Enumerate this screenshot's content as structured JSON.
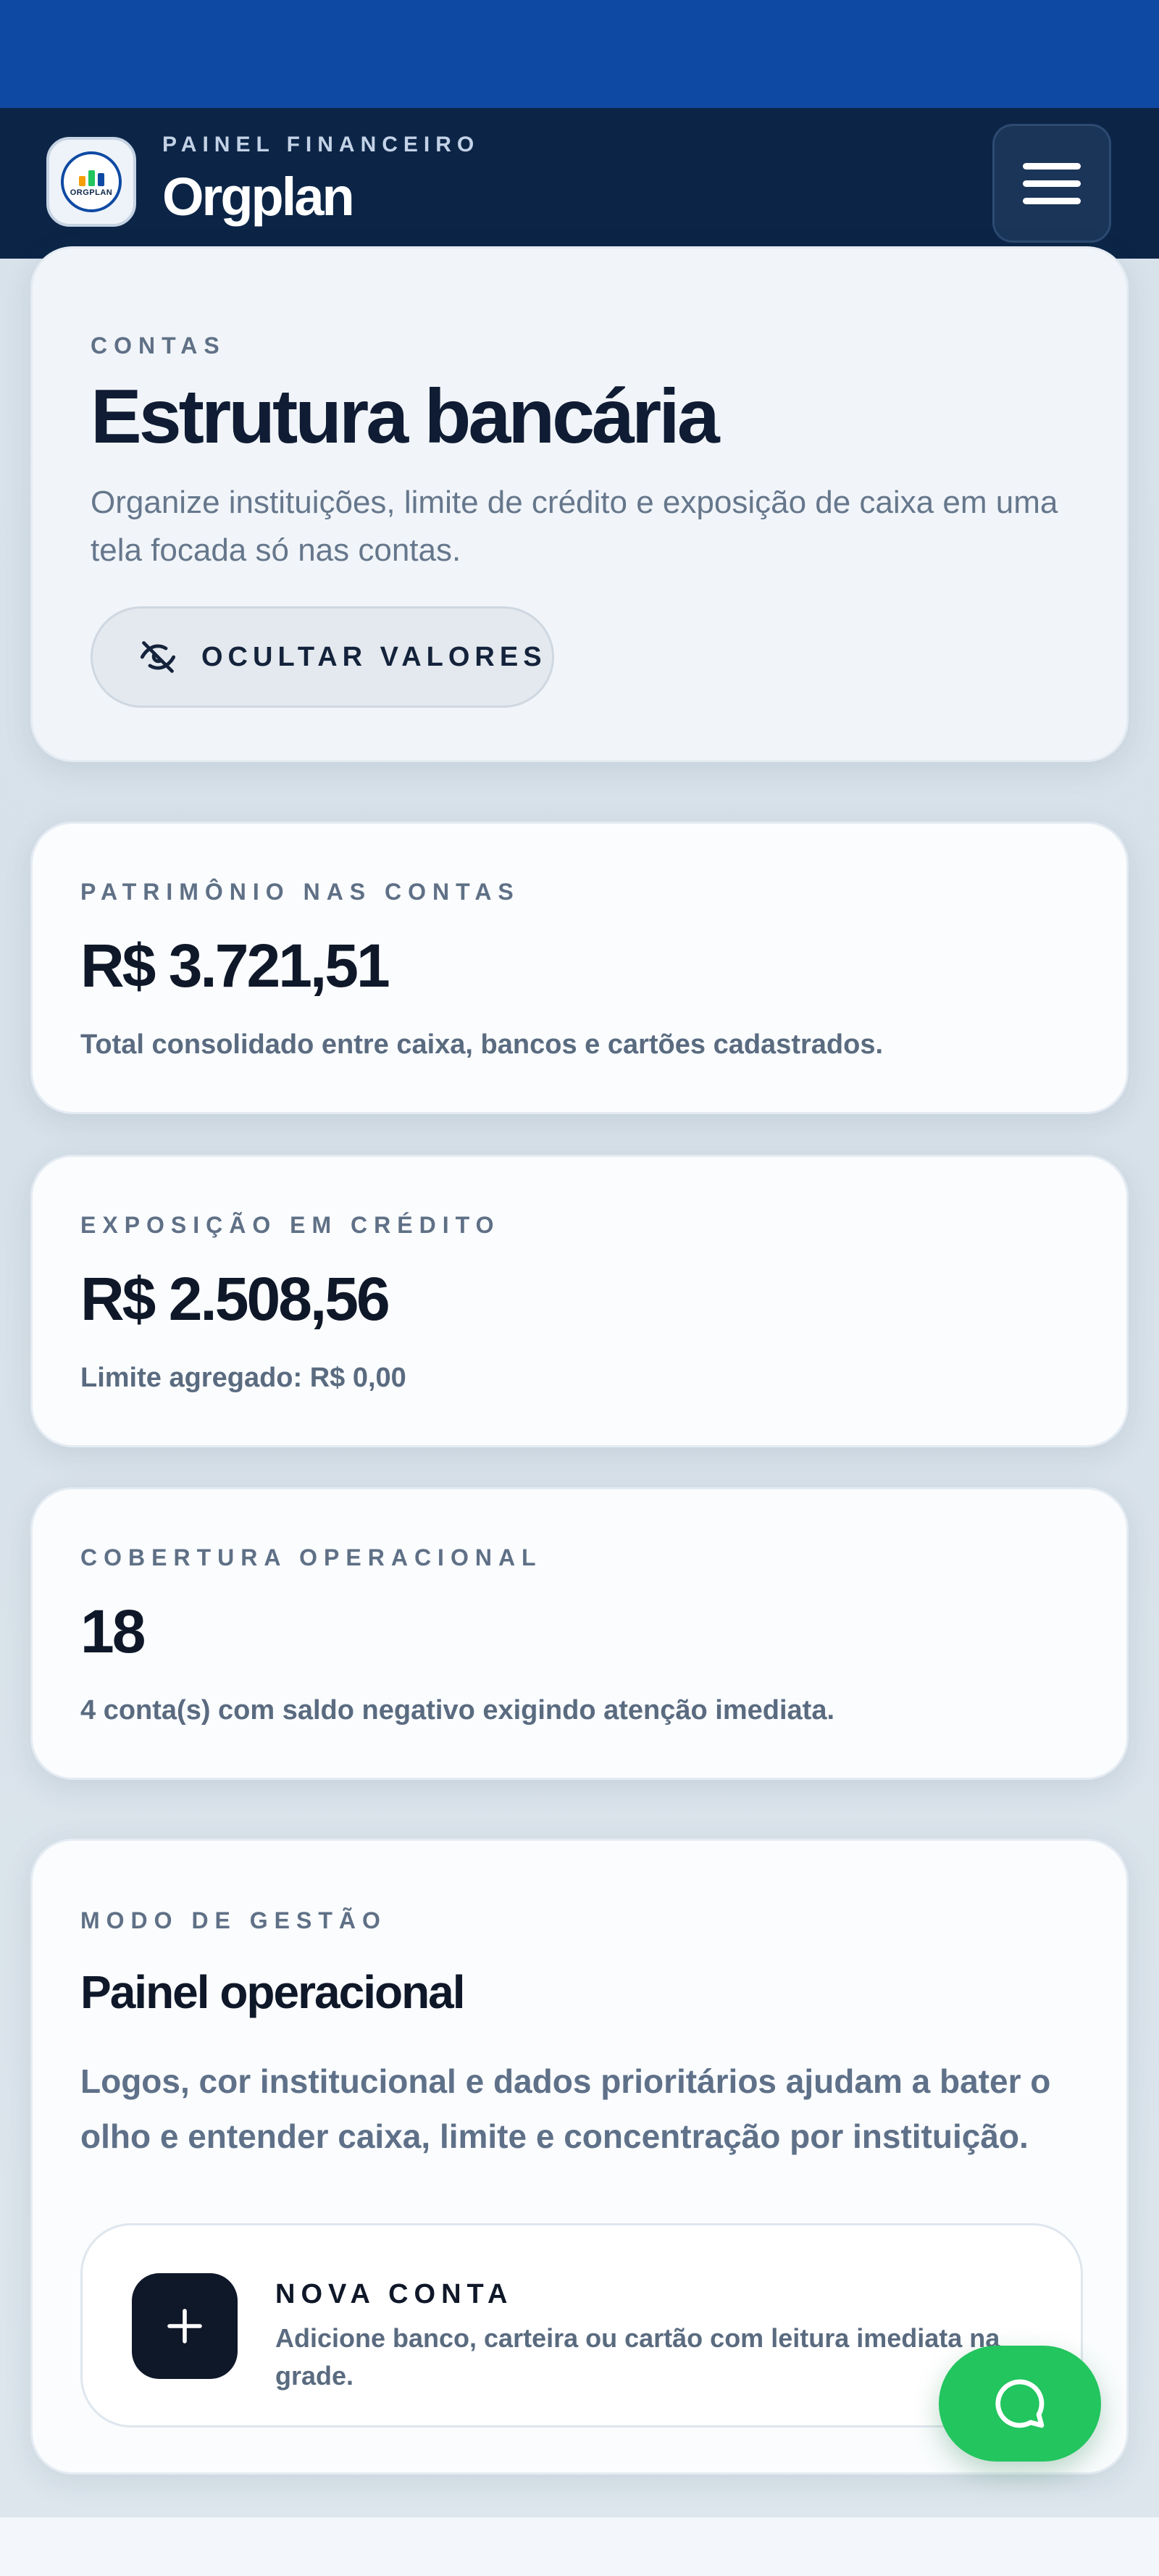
{
  "header": {
    "eyebrow": "PAINEL FINANCEIRO",
    "title": "Orgplan",
    "logo_text": "ORGPLAN"
  },
  "hero": {
    "eyebrow": "CONTAS",
    "title": "Estrutura bancária",
    "description": "Organize instituições, limite de crédito e exposição de caixa em uma tela focada só nas contas.",
    "hide_button_label": "OCULTAR VALORES"
  },
  "stats": [
    {
      "label": "PATRIMÔNIO NAS CONTAS",
      "value": "R$ 3.721,51",
      "note": "Total consolidado entre caixa, bancos e cartões cadastrados."
    },
    {
      "label": "EXPOSIÇÃO EM CRÉDITO",
      "value": "R$ 2.508,56",
      "note": "Limite agregado: R$ 0,00"
    },
    {
      "label": "COBERTURA OPERACIONAL",
      "value": "18",
      "note": "4 conta(s) com saldo negativo exigindo atenção imediata."
    }
  ],
  "mode": {
    "eyebrow": "MODO DE GESTÃO",
    "title": "Painel operacional",
    "description": "Logos, cor institucional e dados prioritários ajudam a bater o olho e entender caixa, limite e concentração por instituição.",
    "new_account_title": "NOVA CONTA",
    "new_account_description": "Adicione banco, carteira ou cartão com leitura imediata na grade."
  },
  "icons": {
    "hide": "eye-off-icon",
    "menu": "hamburger-menu-icon",
    "add": "plus-icon",
    "chat": "chat-bubble-icon"
  },
  "colors": {
    "status_bar": "#0e4aa3",
    "header": "#0c2547",
    "accent_dark": "#0f1829",
    "chat_green": "#22c55e"
  }
}
